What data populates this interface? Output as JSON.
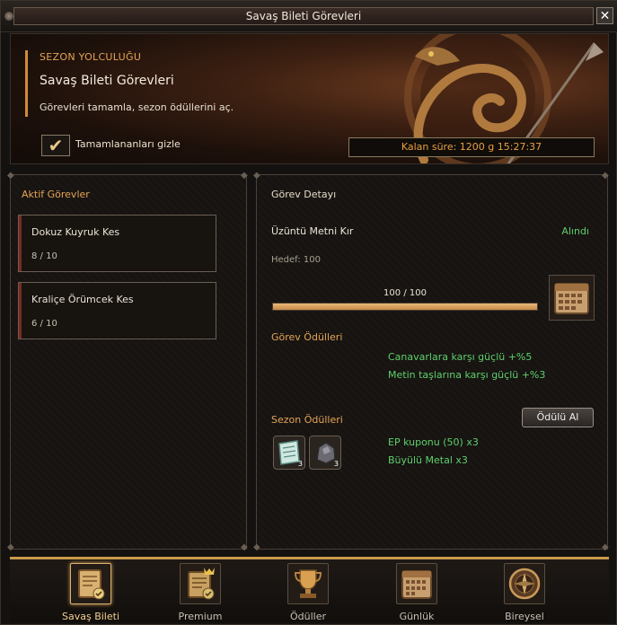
{
  "window": {
    "title": "Savaş Bileti Görevleri"
  },
  "banner": {
    "season_label": "SEZON YOLCULUĞU",
    "title": "Savaş Bileti Görevleri",
    "description": "Görevleri tamamla, sezon ödüllerini aç.",
    "hide_completed_label": "Tamamlananları gizle",
    "hide_completed_checked": true,
    "timer": "Kalan süre: 1200 g 15:27:37"
  },
  "active_quests": {
    "heading": "Aktif Görevler",
    "items": [
      {
        "name": "Dokuz Kuyruk Kes",
        "progress": "8 / 10"
      },
      {
        "name": "Kraliçe Örümcek Kes",
        "progress": "6 / 10"
      }
    ]
  },
  "detail": {
    "heading": "Görev Detayı",
    "quest_name": "Üzüntü Metni Kır",
    "status": "Alındı",
    "target": "Hedef: 100",
    "progress_text": "100 / 100",
    "progress_fraction": 1.0,
    "quest_rewards_heading": "Görev Ödülleri",
    "quest_rewards": [
      "Canavarlara karşı güçlü +%5",
      "Metin taşlarına karşı güçlü +%3"
    ],
    "season_rewards_heading": "Sezon Ödülleri",
    "claim_button": "Ödülü Al",
    "season_rewards": [
      "EP kuponu (50) x3",
      "Büyülü Metal x3"
    ],
    "item_counts": [
      "3",
      "3"
    ],
    "accent_color": "#5fd06a"
  },
  "tabs": [
    {
      "label": "Savaş Bileti",
      "icon": "scroll-check-icon",
      "active": true
    },
    {
      "label": "Premium",
      "icon": "scroll-crown-icon",
      "active": false
    },
    {
      "label": "Ödüller",
      "icon": "trophy-icon",
      "active": false
    },
    {
      "label": "Günlük",
      "icon": "calendar-icon",
      "active": false
    },
    {
      "label": "Bireysel",
      "icon": "compass-icon",
      "active": false
    }
  ]
}
